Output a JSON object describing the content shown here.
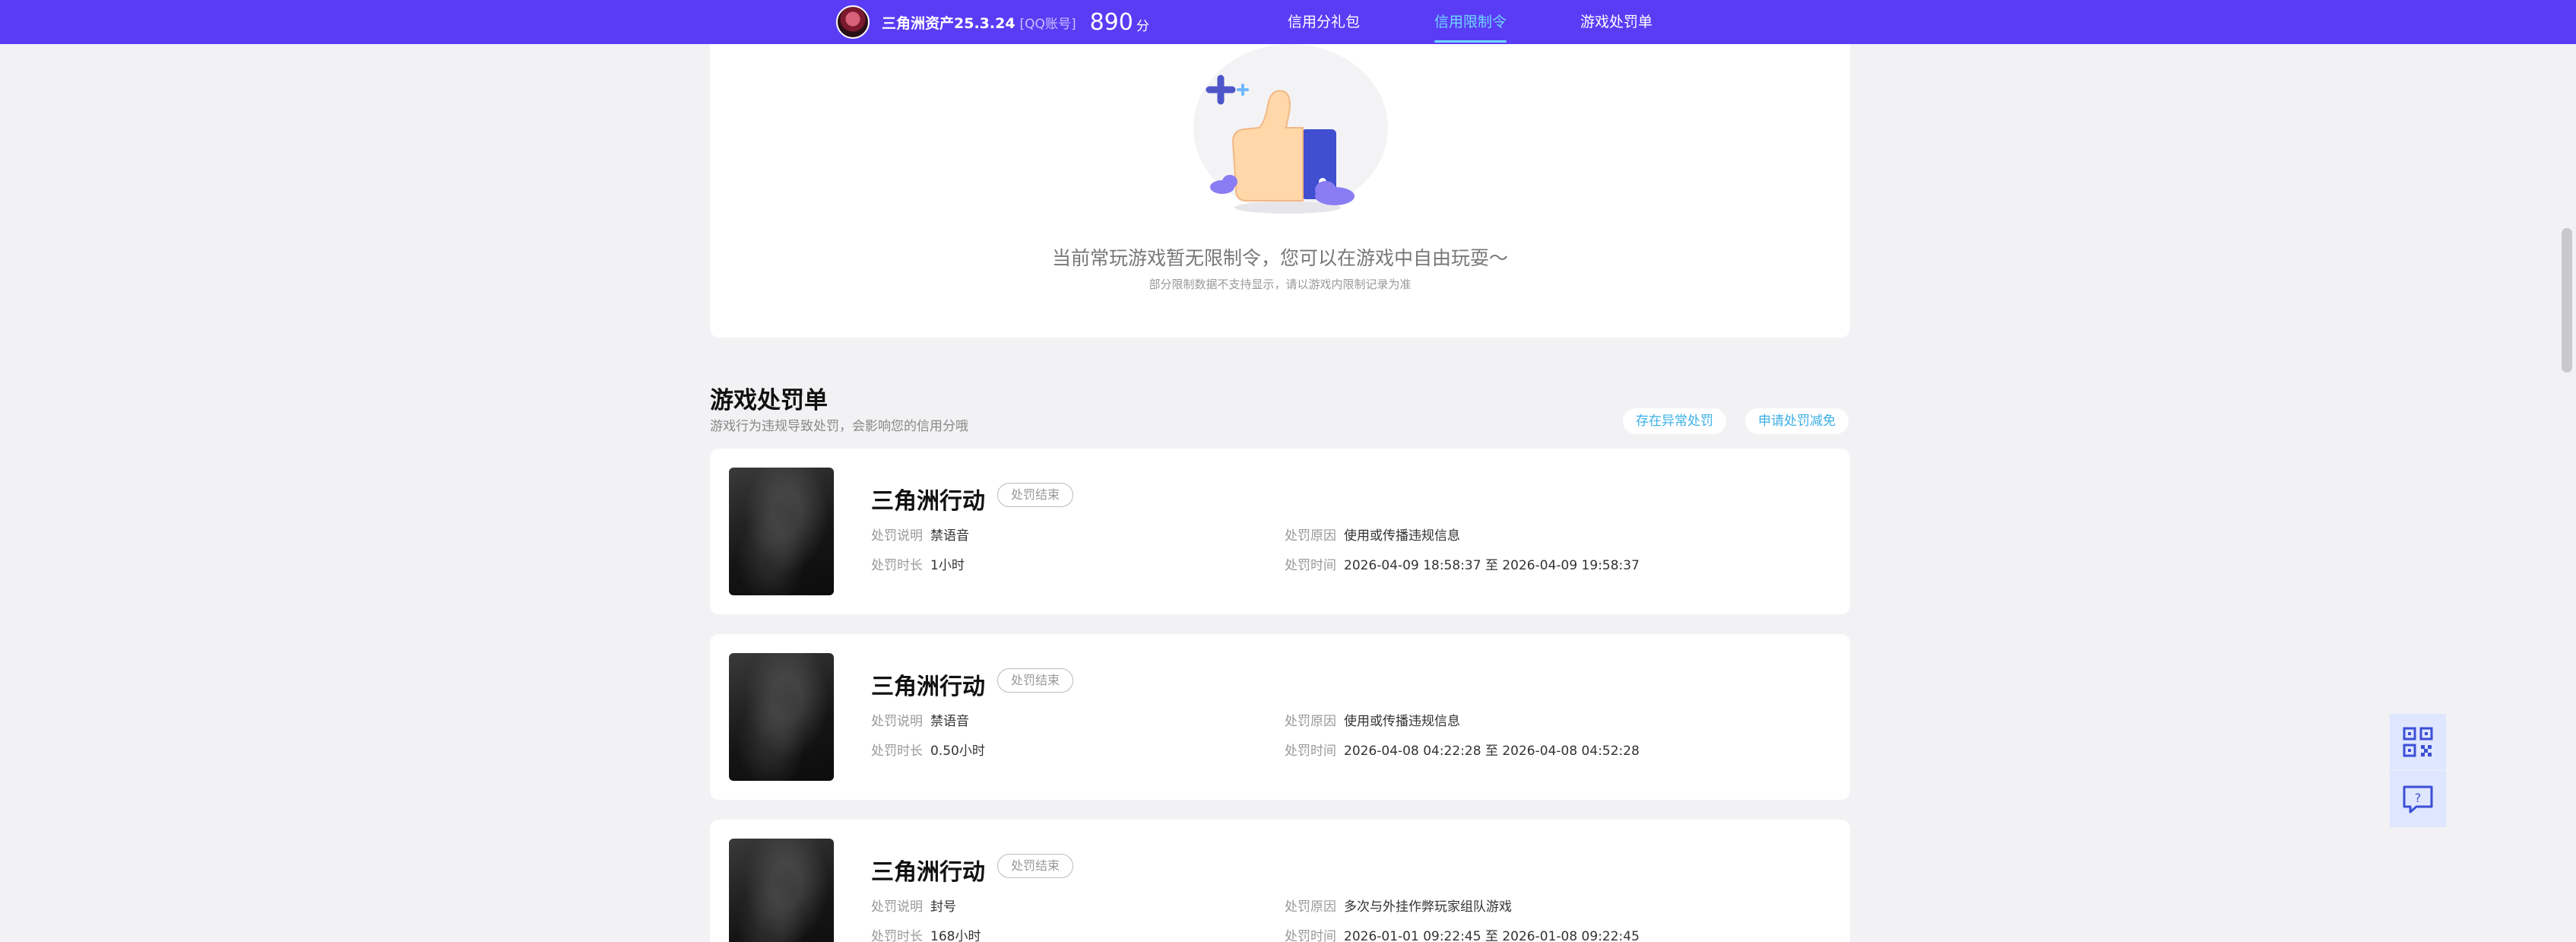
{
  "header": {
    "nickname": "三角洲资产25.3.24",
    "account_type": "[QQ账号]",
    "score": "890",
    "score_unit": "分",
    "tabs": [
      {
        "label": "信用分礼包",
        "active": false
      },
      {
        "label": "信用限制令",
        "active": true
      },
      {
        "label": "游戏处罚单",
        "active": false
      }
    ],
    "colors": {
      "bar": "#5b3cf5",
      "active_tab": "#6fd6ff"
    }
  },
  "restriction": {
    "empty_text": "当前常玩游戏暂无限制令，您可以在游戏中自由玩耍～",
    "empty_note": "部分限制数据不支持显示，请以游戏内限制记录为准"
  },
  "penalties": {
    "title": "游戏处罚单",
    "subtitle": "游戏行为违规导致处罚，会影响您的信用分哦",
    "actions": {
      "abnormal": "存在异常处罚",
      "reduce": "申请处罚减免"
    },
    "labels": {
      "desc": "处罚说明",
      "duration": "处罚时长",
      "reason": "处罚原因",
      "time": "处罚时间"
    },
    "items": [
      {
        "game": "三角洲行动",
        "status": "处罚结束",
        "desc": "禁语音",
        "duration": "1小时",
        "reason": "使用或传播违规信息",
        "time": "2026-04-09 18:58:37 至 2026-04-09 19:58:37"
      },
      {
        "game": "三角洲行动",
        "status": "处罚结束",
        "desc": "禁语音",
        "duration": "0.50小时",
        "reason": "使用或传播违规信息",
        "time": "2026-04-08 04:22:28 至 2026-04-08 04:52:28"
      },
      {
        "game": "三角洲行动",
        "status": "处罚结束",
        "desc": "封号",
        "duration": "168小时",
        "reason": "多次与外挂作弊玩家组队游戏",
        "time": "2026-01-01 09:22:45 至 2026-01-08 09:22:45"
      }
    ]
  },
  "float_buttons": [
    {
      "icon": "qr-code-icon"
    },
    {
      "icon": "help-chat-icon"
    }
  ]
}
